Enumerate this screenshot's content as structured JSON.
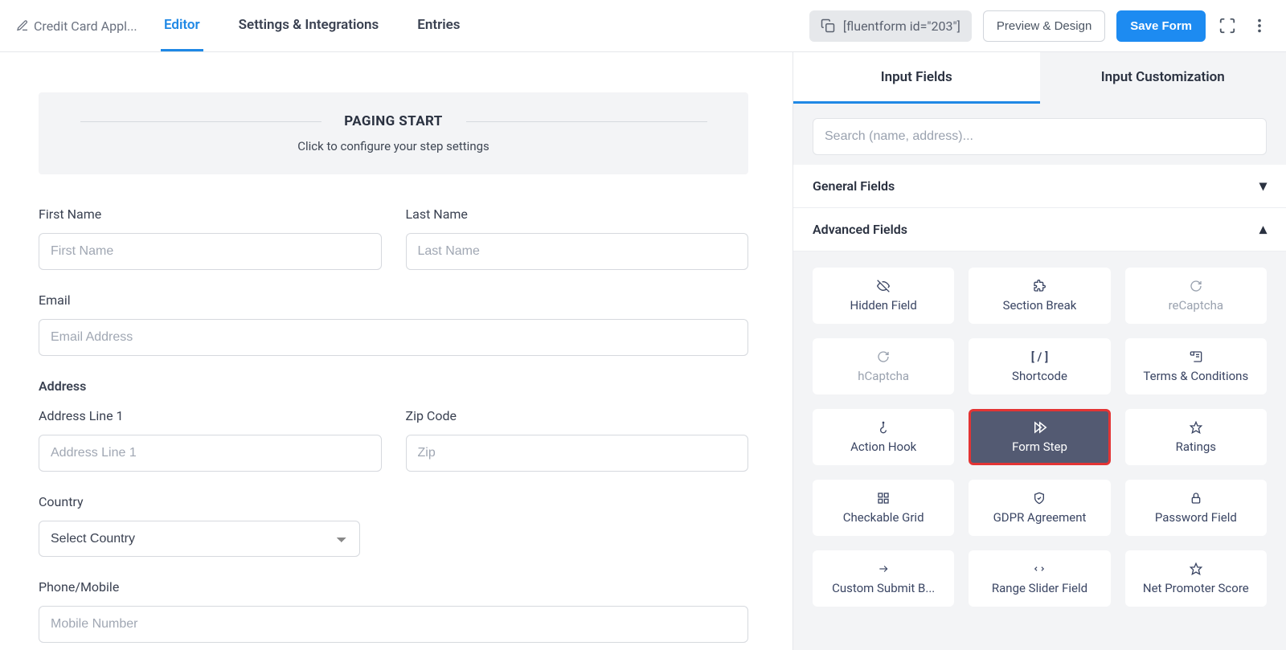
{
  "header": {
    "title": "Credit Card Appl...",
    "tabs": {
      "editor": "Editor",
      "settings": "Settings & Integrations",
      "entries": "Entries"
    },
    "shortcode": "[fluentform id=\"203\"]",
    "preview_btn": "Preview & Design",
    "save_btn": "Save Form"
  },
  "paging": {
    "title": "PAGING START",
    "subtitle": "Click to configure your step settings"
  },
  "form": {
    "first_name": {
      "label": "First Name",
      "placeholder": "First Name"
    },
    "last_name": {
      "label": "Last Name",
      "placeholder": "Last Name"
    },
    "email": {
      "label": "Email",
      "placeholder": "Email Address"
    },
    "address_heading": "Address",
    "address1": {
      "label": "Address Line 1",
      "placeholder": "Address Line 1"
    },
    "zip": {
      "label": "Zip Code",
      "placeholder": "Zip"
    },
    "country": {
      "label": "Country",
      "placeholder": "Select Country"
    },
    "phone": {
      "label": "Phone/Mobile",
      "placeholder": "Mobile Number"
    }
  },
  "sidebar": {
    "tabs": {
      "input_fields": "Input Fields",
      "input_custom": "Input Customization"
    },
    "search_placeholder": "Search (name, address)...",
    "sections": {
      "general": "General Fields",
      "advanced": "Advanced Fields"
    },
    "advanced_fields": [
      {
        "label": "Hidden Field",
        "icon": "eye-off-icon"
      },
      {
        "label": "Section Break",
        "icon": "puzzle-icon"
      },
      {
        "label": "reCaptcha",
        "icon": "refresh-icon",
        "disabled": true
      },
      {
        "label": "hCaptcha",
        "icon": "refresh-icon",
        "disabled": true
      },
      {
        "label": "Shortcode",
        "icon": "brackets-icon"
      },
      {
        "label": "Terms & Conditions",
        "icon": "scroll-icon"
      },
      {
        "label": "Action Hook",
        "icon": "hook-icon"
      },
      {
        "label": "Form Step",
        "icon": "skip-icon",
        "highlight": true
      },
      {
        "label": "Ratings",
        "icon": "star-icon"
      },
      {
        "label": "Checkable Grid",
        "icon": "grid-icon"
      },
      {
        "label": "GDPR Agreement",
        "icon": "shield-icon"
      },
      {
        "label": "Password Field",
        "icon": "lock-icon"
      },
      {
        "label": "Custom Submit B...",
        "icon": "arrow-right-icon"
      },
      {
        "label": "Range Slider Field",
        "icon": "slider-icon"
      },
      {
        "label": "Net Promoter Score",
        "icon": "star-icon"
      }
    ]
  }
}
